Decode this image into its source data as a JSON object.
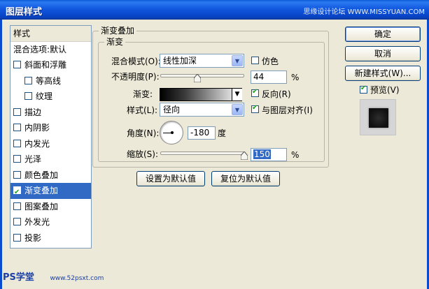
{
  "window": {
    "title": "图层样式",
    "watermark": "思缘设计论坛 WWW.MISSYUAN.COM"
  },
  "style_list": {
    "header": "样式",
    "blend_options": "混合选项:默认",
    "items": [
      {
        "label": "斜面和浮雕",
        "checked": false,
        "indent": false
      },
      {
        "label": "等高线",
        "checked": false,
        "indent": true
      },
      {
        "label": "纹理",
        "checked": false,
        "indent": true
      },
      {
        "label": "描边",
        "checked": false,
        "indent": false
      },
      {
        "label": "内阴影",
        "checked": false,
        "indent": false
      },
      {
        "label": "内发光",
        "checked": false,
        "indent": false
      },
      {
        "label": "光泽",
        "checked": false,
        "indent": false
      },
      {
        "label": "颜色叠加",
        "checked": false,
        "indent": false
      },
      {
        "label": "渐变叠加",
        "checked": true,
        "indent": false,
        "selected": true
      },
      {
        "label": "图案叠加",
        "checked": false,
        "indent": false
      },
      {
        "label": "外发光",
        "checked": false,
        "indent": false
      },
      {
        "label": "投影",
        "checked": false,
        "indent": false
      }
    ]
  },
  "gradient_overlay": {
    "group_title": "渐变叠加",
    "sub_title": "渐变",
    "blend_mode_label": "混合模式(O):",
    "blend_mode_value": "线性加深",
    "dither_label": "仿色",
    "opacity_label": "不透明度(P):",
    "opacity_value": "44",
    "opacity_percent": 0.44,
    "gradient_label": "渐变:",
    "reverse_label": "反向(R)",
    "style_label": "样式(L):",
    "style_value": "径向",
    "align_label": "与图层对齐(I)",
    "angle_label": "角度(N):",
    "angle_value": "-180",
    "angle_unit": "度",
    "scale_label": "缩放(S):",
    "scale_value": "150",
    "scale_percent": 1.5,
    "percent_sign": "%",
    "make_default": "设置为默认值",
    "reset_default": "复位为默认值"
  },
  "actions": {
    "ok": "确定",
    "cancel": "取消",
    "new_style": "新建样式(W)...",
    "preview_label": "预览(V)"
  },
  "brand": {
    "text": "PS学堂",
    "url": "www.52psxt.com"
  }
}
